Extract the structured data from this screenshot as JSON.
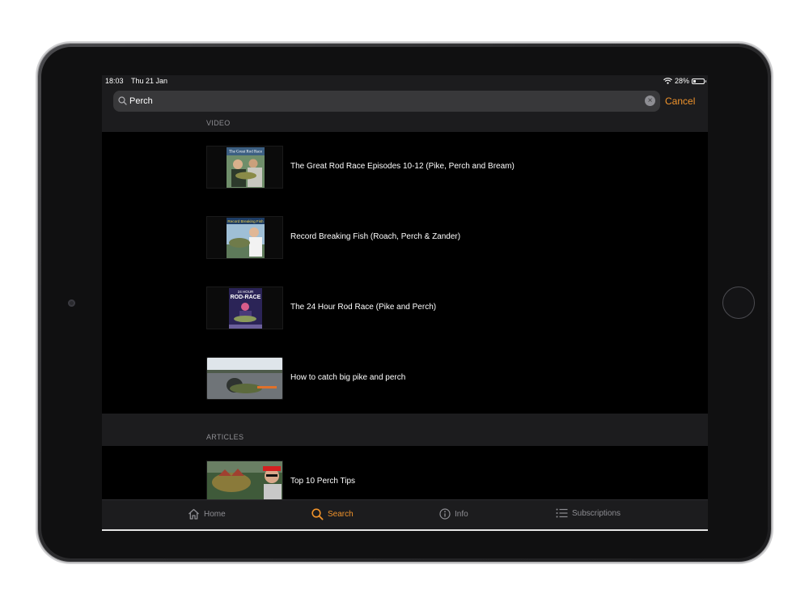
{
  "status_bar": {
    "time": "18:03",
    "date": "Thu 21 Jan",
    "battery_text": "28%",
    "battery_level": 0.28
  },
  "search": {
    "value": "Perch",
    "cancel_label": "Cancel"
  },
  "sections": {
    "video": {
      "header": "VIDEO",
      "items": [
        {
          "title": "The Great Rod Race Episodes 10-12 (Pike, Perch and Bream)",
          "thumb_caption": "The Great Rod Race"
        },
        {
          "title": "Record Breaking Fish (Roach, Perch & Zander)",
          "thumb_caption": "Record Breaking Fish"
        },
        {
          "title": "The 24 Hour Rod Race (Pike and Perch)",
          "thumb_caption_top": "24 HOUR",
          "thumb_caption_main": "ROD-RACE"
        },
        {
          "title": "How to catch big pike and perch"
        }
      ]
    },
    "articles": {
      "header": "ARTICLES",
      "items": [
        {
          "title": "Top 10 Perch Tips"
        }
      ]
    }
  },
  "tabs": [
    {
      "label": "Home",
      "icon": "house-icon",
      "active": false
    },
    {
      "label": "Search",
      "icon": "search-icon",
      "active": true
    },
    {
      "label": "Info",
      "icon": "info-icon",
      "active": false
    },
    {
      "label": "Subscriptions",
      "icon": "list-icon",
      "active": false
    }
  ],
  "colors": {
    "accent": "#f0932b",
    "background": "#000000",
    "bar_background": "#1c1c1e",
    "search_field": "#38383a",
    "inactive_tab": "#8e8e93"
  }
}
